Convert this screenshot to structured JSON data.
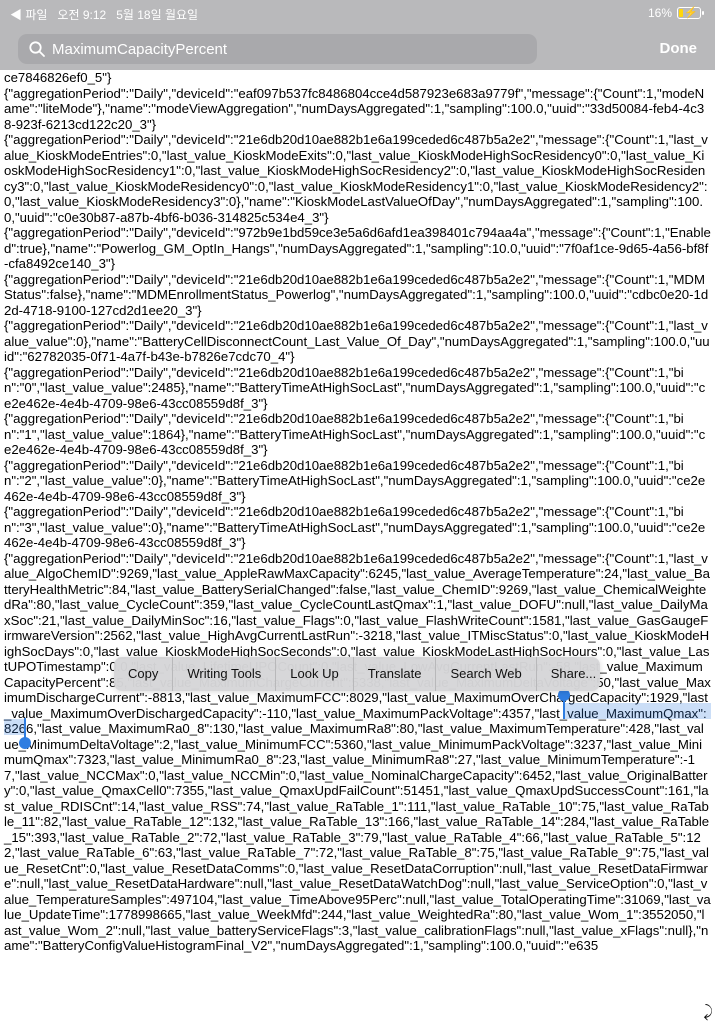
{
  "status_bar": {
    "back_app": "◀ 파일",
    "time": "오전 9:12",
    "date": "5월 18일 월요일",
    "battery_percent": "16%"
  },
  "search": {
    "query": "MaximumCapacityPercent",
    "done_label": "Done"
  },
  "log_lines": [
    "ce7846826ef0_5\"}",
    "{\"aggregationPeriod\":\"Daily\",\"deviceId\":\"eaf097b537fc8486804cce4d587923e683a9779f\",\"message\":{\"Count\":1,\"modeName\":\"liteMode\"},\"name\":\"modeViewAggregation\",\"numDaysAggregated\":1,\"sampling\":100.0,\"uuid\":\"33d50084-feb4-4c38-923f-6213cd122c20_3\"}",
    "{\"aggregationPeriod\":\"Daily\",\"deviceId\":\"21e6db20d10ae882b1e6a199ceded6c487b5a2e2\",\"message\":{\"Count\":1,\"last_value_KioskModeEntries\":0,\"last_value_KioskModeExits\":0,\"last_value_KioskModeHighSocResidency0\":0,\"last_value_KioskModeHighSocResidency1\":0,\"last_value_KioskModeHighSocResidency2\":0,\"last_value_KioskModeHighSocResidency3\":0,\"last_value_KioskModeResidency0\":0,\"last_value_KioskModeResidency1\":0,\"last_value_KioskModeResidency2\":0,\"last_value_KioskModeResidency3\":0},\"name\":\"KioskModeLastValueOfDay\",\"numDaysAggregated\":1,\"sampling\":100.0,\"uuid\":\"c0e30b87-a87b-4bf6-b036-314825c534e4_3\"}",
    "{\"aggregationPeriod\":\"Daily\",\"deviceId\":\"972b9e1bd59ce3e5a6d6afd1ea398401c794aa4a\",\"message\":{\"Count\":1,\"Enabled\":true},\"name\":\"Powerlog_GM_OptIn_Hangs\",\"numDaysAggregated\":1,\"sampling\":10.0,\"uuid\":\"7f0af1ce-9d65-4a56-bf8f-cfa8492ce140_3\"}",
    "{\"aggregationPeriod\":\"Daily\",\"deviceId\":\"21e6db20d10ae882b1e6a199ceded6c487b5a2e2\",\"message\":{\"Count\":1,\"MDMStatus\":false},\"name\":\"MDMEnrollmentStatus_Powerlog\",\"numDaysAggregated\":1,\"sampling\":100.0,\"uuid\":\"cdbc0e20-1d2d-4718-9100-127cd2d1ee20_3\"}",
    "{\"aggregationPeriod\":\"Daily\",\"deviceId\":\"21e6db20d10ae882b1e6a199ceded6c487b5a2e2\",\"message\":{\"Count\":1,\"last_value_value\":0},\"name\":\"BatteryCellDisconnectCount_Last_Value_Of_Day\",\"numDaysAggregated\":1,\"sampling\":100.0,\"uuid\":\"62782035-0f71-4a7f-b43e-b7826e7cdc70_4\"}",
    "{\"aggregationPeriod\":\"Daily\",\"deviceId\":\"21e6db20d10ae882b1e6a199ceded6c487b5a2e2\",\"message\":{\"Count\":1,\"bin\":\"0\",\"last_value_value\":2485},\"name\":\"BatteryTimeAtHighSocLast\",\"numDaysAggregated\":1,\"sampling\":100.0,\"uuid\":\"ce2e462e-4e4b-4709-98e6-43cc08559d8f_3\"}",
    "{\"aggregationPeriod\":\"Daily\",\"deviceId\":\"21e6db20d10ae882b1e6a199ceded6c487b5a2e2\",\"message\":{\"Count\":1,\"bin\":\"1\",\"last_value_value\":1864},\"name\":\"BatteryTimeAtHighSocLast\",\"numDaysAggregated\":1,\"sampling\":100.0,\"uuid\":\"ce2e462e-4e4b-4709-98e6-43cc08559d8f_3\"}",
    "{\"aggregationPeriod\":\"Daily\",\"deviceId\":\"21e6db20d10ae882b1e6a199ceded6c487b5a2e2\",\"message\":{\"Count\":1,\"bin\":\"2\",\"last_value_value\":0},\"name\":\"BatteryTimeAtHighSocLast\",\"numDaysAggregated\":1,\"sampling\":100.0,\"uuid\":\"ce2e462e-4e4b-4709-98e6-43cc08559d8f_3\"}",
    "{\"aggregationPeriod\":\"Daily\",\"deviceId\":\"21e6db20d10ae882b1e6a199ceded6c487b5a2e2\",\"message\":{\"Count\":1,\"bin\":\"3\",\"last_value_value\":0},\"name\":\"BatteryTimeAtHighSocLast\",\"numDaysAggregated\":1,\"sampling\":100.0,\"uuid\":\"ce2e462e-4e4b-4709-98e6-43cc08559d8f_3\"}",
    "{\"aggregationPeriod\":\"Daily\",\"deviceId\":\"21e6db20d10ae882b1e6a199ceded6c487b5a2e2\",\"message\":{\"Count\":1,\"last_value_AlgoChemID\":9269,\"last_value_AppleRawMaxCapacity\":6245,\"last_value_AverageTemperature\":24,\"last_value_BatteryHealthMetric\":84,\"last_value_BatterySerialChanged\":false,\"last_value_ChemID\":9269,\"last_value_ChemicalWeightedRa\":80,\"last_value_CycleCount\":359,\"last_value_CycleCountLastQmax\":1,\"last_value_DOFU\":null,\"last_value_DailyMaxSoc\":21,\"last_value_DailyMinSoc\":16,\"last_value_Flags\":0,\"last_value_FlashWriteCount\":1581,\"last_value_GasGaugeFirmwareVersion\":2562,\"last_value_HighAvgCurrentLastRun\":-3218,\"last_value_ITMiscStatus\":0,\"last_value_KioskModeHighSocDays\":0,\"last_value_KioskModeHighSocSeconds\":0,\"last_value_KioskModeLastHighSocHours\":0,\"last_value_LastUPOTimestamp\":0.0,\"last_value_LifetimeUPOCount\":0,\"last_value_LowAvgCurrentLastRun\":-58,\"last_value_MaximumCapacityPercent\":85,\"last_value_MaximumChargeCurrent\":5338,\"last_value_MaximumDeltaVoltage\":50,\"last_value_MaximumDischargeCurrent\":-8813,\"last_value_MaximumFCC\":8029,\"last_value_MaximumOverChargedCapacity\":1929,\"last_value_MaximumOverDischargedCapacity\":-110,\"last_value_MaximumPackVoltage\":4357,\"last_value_MaximumQmax\":8266,\"last_value_MaximumRa0_8\":130,\"last_value_MaximumRa8\":80,\"last_value_MaximumTemperature\":428,\"last_value_MinimumDeltaVoltage\":2,\"last_value_MinimumFCC\":5360,\"last_value_MinimumPackVoltage\":3237,\"last_value_MinimumQmax\":7323,\"last_value_MinimumRa0_8\":23,\"last_value_MinimumRa8\":27,\"last_value_MinimumTemperature\":-17,\"last_value_NCCMax\":0,\"last_value_NCCMin\":0,\"last_value_NominalChargeCapacity\":6452,\"last_value_OriginalBattery\":0,\"last_value_QmaxCell0\":7355,\"last_value_QmaxUpdFailCount\":51451,\"last_value_QmaxUpdSuccessCount\":161,\"last_value_RDISCnt\":14,\"last_value_RSS\":74,\"last_value_RaTable_1\":111,\"last_value_RaTable_10\":75,\"last_value_RaTable_11\":82,\"last_value_RaTable_12\":132,\"last_value_RaTable_13\":166,\"last_value_RaTable_14\":284,\"last_value_RaTable_15\":393,\"last_value_RaTable_2\":72,\"last_value_RaTable_3\":79,\"last_value_RaTable_4\":66,\"last_value_RaTable_5\":122,\"last_value_RaTable_6\":63,\"last_value_RaTable_7\":72,\"last_value_RaTable_8\":75,\"last_value_RaTable_9\":75,\"last_value_ResetCnt\":0,\"last_value_ResetDataComms\":0,\"last_value_ResetDataCorruption\":null,\"last_value_ResetDataFirmware\":null,\"last_value_ResetDataHardware\":null,\"last_value_ResetDataWatchDog\":null,\"last_value_ServiceOption\":0,\"last_value_TemperatureSamples\":497104,\"last_value_TimeAbove95Perc\":null,\"last_value_TotalOperatingTime\":31069,\"last_value_UpdateTime\":1778998665,\"last_value_WeekMfd\":244,\"last_value_WeightedRa\":80,\"last_value_Wom_1\":3552050,\"last_value_Wom_2\":null,\"last_value_batteryServiceFlags\":3,\"last_value_calibrationFlags\":null,\"last_value_xFlags\":null},\"name\":\"BatteryConfigValueHistogramFinal_V2\",\"numDaysAggregated\":1,\"sampling\":100.0,\"uuid\":\"e635"
  ],
  "edit_menu": [
    "Copy",
    "Writing Tools",
    "Look Up",
    "Translate",
    "Search Web",
    "Share..."
  ]
}
